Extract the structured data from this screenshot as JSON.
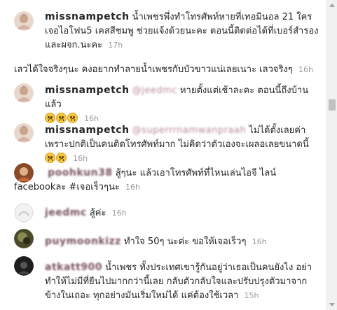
{
  "comments": [
    {
      "username": "missnampetch",
      "text": "น้ำเพชรพึ่งทำโทรศัพท์หายที่เทอมินอล 21 ใครเจอไอโฟน5 เคสสีชมพู ช่วยแจ้งด้วยนะคะ ตอนนี้ติดต่อได้ที่เบอร์สำรอง และผจก.นะคะ",
      "time": "17h"
    },
    {
      "username": "",
      "text": "เลวได้ใจจริงๆนะ คงอยากทำลายน้ำเพชรกับบัวขาวแน่เลยเนาะ เลวจริงๆ",
      "time": "16h"
    },
    {
      "username": "missnampetch",
      "mention": "@jeedmc",
      "text": " หายตั้งแต่เช้าละคะ ตอนนี้ถึงบ้านแล้ว",
      "time": "16h"
    },
    {
      "username": "missnampetch",
      "mention": "@superrrnamwanpraah",
      "text": " ไม่ได้ตั้งเลยค่า เพราะปกติเป็นคนติดโทรศัพท์มาก ไม่คิดว่าตัวเองจะเผลอเลยขนาดนี้",
      "time": "16h"
    },
    {
      "username": "poohkun38",
      "text": " สู้ๆนะ แล้วเอาโทรศัพท์ที่ไหนเล่นไอจี ไลน์ facebookละ",
      "hashtag": "#เจอเร็วๆนะ",
      "time": "16h"
    },
    {
      "username": "jeedmc",
      "text": " สู้ค่ะ",
      "time": "16h"
    },
    {
      "username": "puymoonkizz",
      "text": " ทำใจ 50ๆ นะค่ะ ขอให้เจอเร็วๆ",
      "time": "16h"
    },
    {
      "username": "atkatt900",
      "text": " น้ำเพชร ทั้งประเทศเขารู้กันอยู่ว่าเธอเป็นคนยังไง อย่าทำให้ไม่มีที่ยืนไปมากกว่านี้เลย กลับตัวกลับใจและปรับปรุงตัวมาจากข้างในเถอะ ทุกอย่างมันเริ่มใหม่ได้ แค่ต้องใช้เวลา",
      "time": "15h"
    }
  ],
  "colors": {
    "username": "#262626",
    "timestamp": "#999999",
    "blurred_mention": "#bb8aa0"
  }
}
